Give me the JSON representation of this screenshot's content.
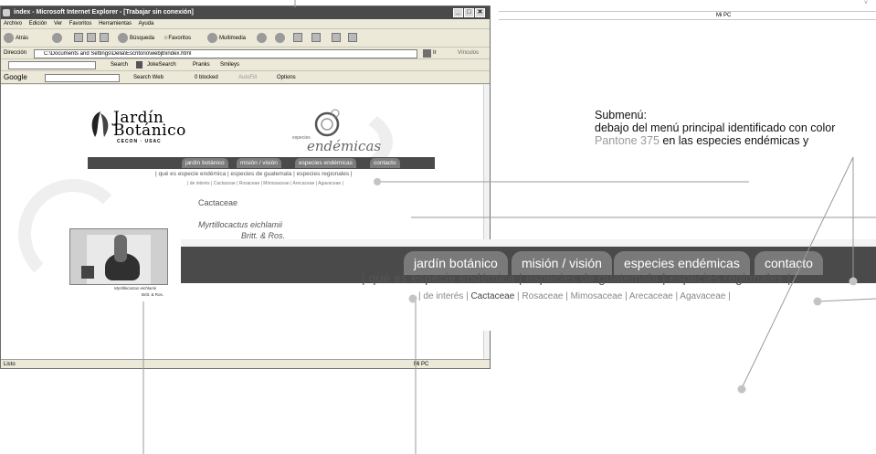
{
  "window": {
    "title": "index - Microsoft Internet Explorer - [Trabajar sin conexión]",
    "minimize": "_",
    "maximize": "□",
    "close": "✕"
  },
  "menubar": [
    "Archivo",
    "Edición",
    "Ver",
    "Favoritos",
    "Herramientas",
    "Ayuda"
  ],
  "toolbar": {
    "back": "Atrás",
    "search": "Búsqueda",
    "favorites": "Favoritos",
    "multimedia": "Multimedia"
  },
  "address": {
    "label": "Dirección",
    "value": "C:\\Documents and Settings\\Delia\\Escritorio\\webjb\\index.html",
    "go": "Ir",
    "links": "Vínculos"
  },
  "linkbar": {
    "search": "Search",
    "jokesearch": "JokeSearch",
    "pranks": "Pranks",
    "smileys": "Smileys"
  },
  "googlebar": {
    "label": "Google",
    "search_web": "Search Web",
    "blocked": "0 blocked",
    "autofill": "AutoFill",
    "options": "Options"
  },
  "statusbar": {
    "left": "Listo",
    "right": "Mi PC"
  },
  "page": {
    "logo_title": "Jardín Botánico",
    "logo_line1": "Jardín",
    "logo_line2": "Botánico",
    "logo_sub": "CECON · USAC",
    "endemic_small": "especies",
    "endemic_big": "endémicas",
    "nav": [
      "jardín botánico",
      "misión / visión",
      "especies endémicas",
      "contacto"
    ],
    "submenu": "| qué es especie endémica  |  especies de guatemala  |  especies regionales |",
    "submenu2": "| de interés  | Cactaceae | Rosaceae | Mimosaceae | Arecaceae | Agavaceae |",
    "family_title": "Cactaceae",
    "species": "Myrtillocactus eichlamii",
    "author": "Britt. & Ros.",
    "photo_caption": "Myrtillocactus eichlamii",
    "photo_caption2": "Britt. & Ros."
  },
  "zoom": {
    "nav": [
      "jardín botánico",
      "misión / visión",
      "especies endémicas",
      "contacto"
    ],
    "submenu": "| qué es especie endémica  |  especies de guatemala  |  especies regionales |",
    "submenu2_lead": "| de interés  |",
    "submenu2_active": "Cactaceae",
    "submenu2_rest": "| Rosaceae | Mimosaceae | Arecaceae | Agavaceae |"
  },
  "mini_window": {
    "status_right": "Mi PC"
  },
  "annotation": {
    "heading": "Submenú:",
    "line1": "debajo del menú principal identificado con color",
    "pantone": "Pantone 375",
    "line2_rest": "en las especies endémicas y"
  },
  "colors": {
    "nav_bar": "#4a4a4a",
    "nav_tab": "#7a7a7a",
    "dot": "#c4c4c4",
    "pantone": "#9a9a9a"
  }
}
